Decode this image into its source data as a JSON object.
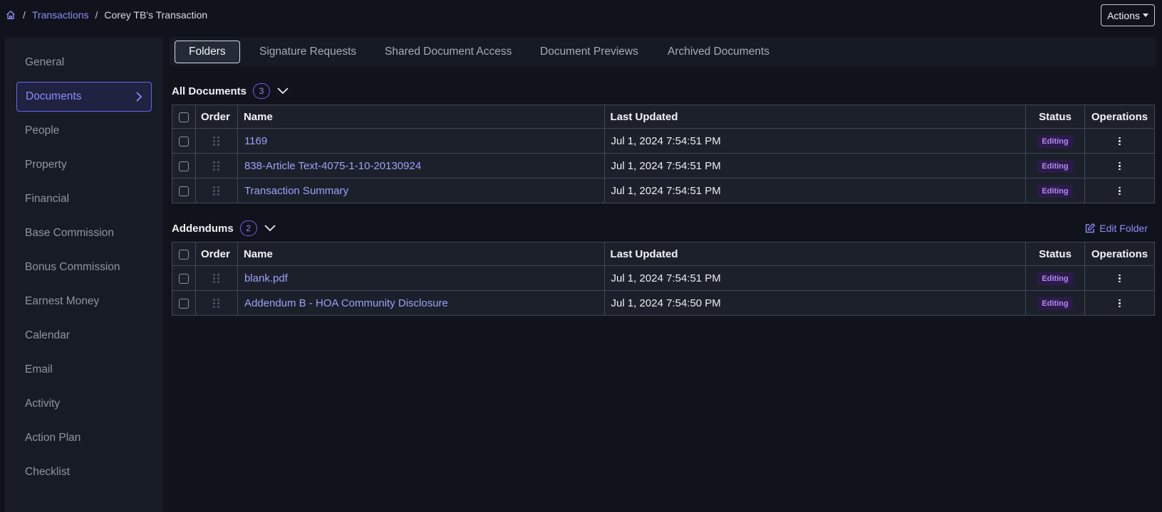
{
  "breadcrumb": {
    "home_icon": "home-icon",
    "separator": "/",
    "link": "Transactions",
    "current": "Corey TB's Transaction"
  },
  "header": {
    "actions_label": "Actions"
  },
  "sidebar": {
    "items": [
      {
        "label": "General"
      },
      {
        "label": "Documents",
        "active": true
      },
      {
        "label": "People"
      },
      {
        "label": "Property"
      },
      {
        "label": "Financial"
      },
      {
        "label": "Base Commission"
      },
      {
        "label": "Bonus Commission"
      },
      {
        "label": "Earnest Money"
      },
      {
        "label": "Calendar"
      },
      {
        "label": "Email"
      },
      {
        "label": "Activity"
      },
      {
        "label": "Action Plan"
      },
      {
        "label": "Checklist"
      }
    ]
  },
  "tabs": [
    {
      "label": "Folders",
      "active": true
    },
    {
      "label": "Signature Requests"
    },
    {
      "label": "Shared Document Access"
    },
    {
      "label": "Document Previews"
    },
    {
      "label": "Archived Documents"
    }
  ],
  "columns": {
    "order": "Order",
    "name": "Name",
    "last_updated": "Last Updated",
    "status": "Status",
    "operations": "Operations"
  },
  "folders": [
    {
      "title": "All Documents",
      "count": "3",
      "rows": [
        {
          "name": "1169",
          "updated": "Jul 1, 2024 7:54:51 PM",
          "status": "Editing"
        },
        {
          "name": "838-Article Text-4075-1-10-20130924",
          "updated": "Jul 1, 2024 7:54:51 PM",
          "status": "Editing"
        },
        {
          "name": "Transaction Summary",
          "updated": "Jul 1, 2024 7:54:51 PM",
          "status": "Editing"
        }
      ]
    },
    {
      "title": "Addendums",
      "count": "2",
      "edit_label": "Edit Folder",
      "rows": [
        {
          "name": "blank.pdf",
          "updated": "Jul 1, 2024 7:54:51 PM",
          "status": "Editing"
        },
        {
          "name": "Addendum B - HOA Community Disclosure",
          "updated": "Jul 1, 2024 7:54:50 PM",
          "status": "Editing"
        }
      ]
    }
  ],
  "colors": {
    "accent": "#8b8cf6",
    "background": "#10131c",
    "status_bg": "#2c1b4a",
    "status_text": "#b089f0"
  }
}
